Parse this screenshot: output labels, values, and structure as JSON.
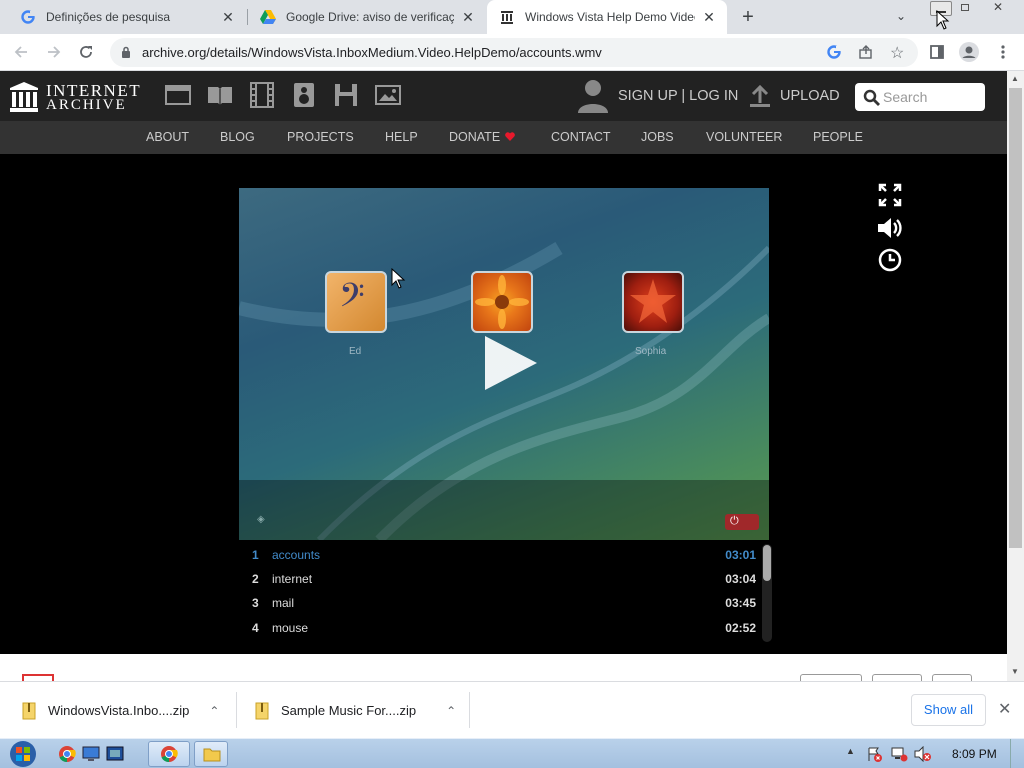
{
  "browser": {
    "tabs": [
      {
        "title": "Definições de pesquisa",
        "favicon": "google-g-icon"
      },
      {
        "title": "Google Drive: aviso de verificação",
        "favicon": "google-drive-icon"
      },
      {
        "title": "Windows Vista Help Demo Video",
        "favicon": "internet-archive-icon",
        "active": true
      }
    ],
    "url": "archive.org/details/WindowsVista.InboxMedium.Video.HelpDemo/accounts.wmv"
  },
  "ia": {
    "logo_line1": "INTERNET",
    "logo_line2": "ARCHIVE",
    "signup": "SIGN UP | LOG IN",
    "upload": "UPLOAD",
    "search_placeholder": "Search",
    "nav": [
      "ABOUT",
      "BLOG",
      "PROJECTS",
      "HELP",
      "DONATE",
      "CONTACT",
      "JOBS",
      "VOLUNTEER",
      "PEOPLE"
    ],
    "donate_color": "#e8192c"
  },
  "video": {
    "users": [
      {
        "name": "Ed"
      },
      {
        "name": ""
      },
      {
        "name": "Sophia"
      }
    ]
  },
  "playlist": [
    {
      "num": "1",
      "name": "accounts",
      "duration": "03:01",
      "active": true
    },
    {
      "num": "2",
      "name": "internet",
      "duration": "03:04"
    },
    {
      "num": "3",
      "name": "mail",
      "duration": "03:45"
    },
    {
      "num": "4",
      "name": "mouse",
      "duration": "02:52"
    }
  ],
  "accent": "#428bca",
  "downloads": [
    {
      "name": "WindowsVista.Inbo....zip"
    },
    {
      "name": "Sample Music For....zip"
    }
  ],
  "show_all": "Show all",
  "clock": "8:09 PM"
}
